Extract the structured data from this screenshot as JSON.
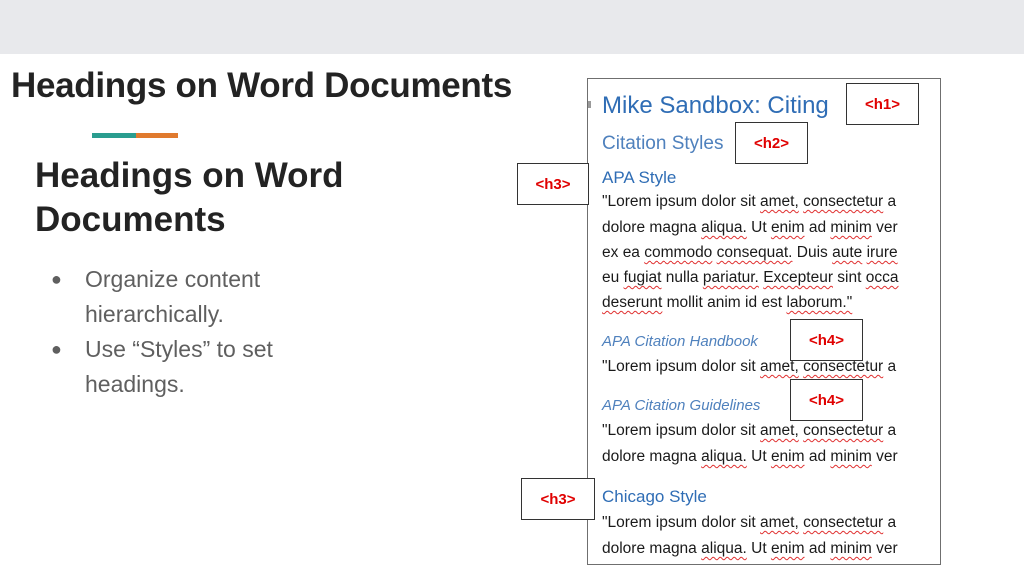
{
  "slide": {
    "title": "Headings on Word Documents",
    "subtitle": "Headings on Word Documents",
    "bullets": [
      "Organize content hierarchically.",
      "Use “Styles” to set headings."
    ],
    "accent_colors": {
      "teal": "#2a9d8f",
      "orange": "#e07a2e"
    }
  },
  "document": {
    "title": "Mike Sandbox: Citing",
    "heading2": "Citation Styles",
    "heading3_a": "APA Style",
    "para1_lines": [
      "\"Lorem ipsum dolor sit amet, consectetur a",
      "dolore magna aliqua. Ut enim ad minim ver",
      "ex ea commodo consequat. Duis aute irure",
      "eu fugiat nulla pariatur. Excepteur sint occa",
      "deserunt mollit anim id est laborum.\""
    ],
    "heading4_a": "APA Citation Handbook",
    "para2_lines": [
      "\"Lorem ipsum dolor sit amet, consectetur a"
    ],
    "heading4_b": "APA Citation Guidelines",
    "para3_lines": [
      "\"Lorem ipsum dolor sit amet, consectetur a",
      "dolore magna aliqua. Ut enim ad minim ver"
    ],
    "heading3_b": "Chicago Style",
    "para4_lines": [
      "\"Lorem ipsum dolor sit amet, consectetur a",
      "dolore magna aliqua. Ut enim ad minim ver"
    ]
  },
  "tags": {
    "h1": "<h1>",
    "h2": "<h2>",
    "h3_a": "<h3>",
    "h4_a": "<h4>",
    "h4_b": "<h4>",
    "h3_b": "<h3>"
  }
}
